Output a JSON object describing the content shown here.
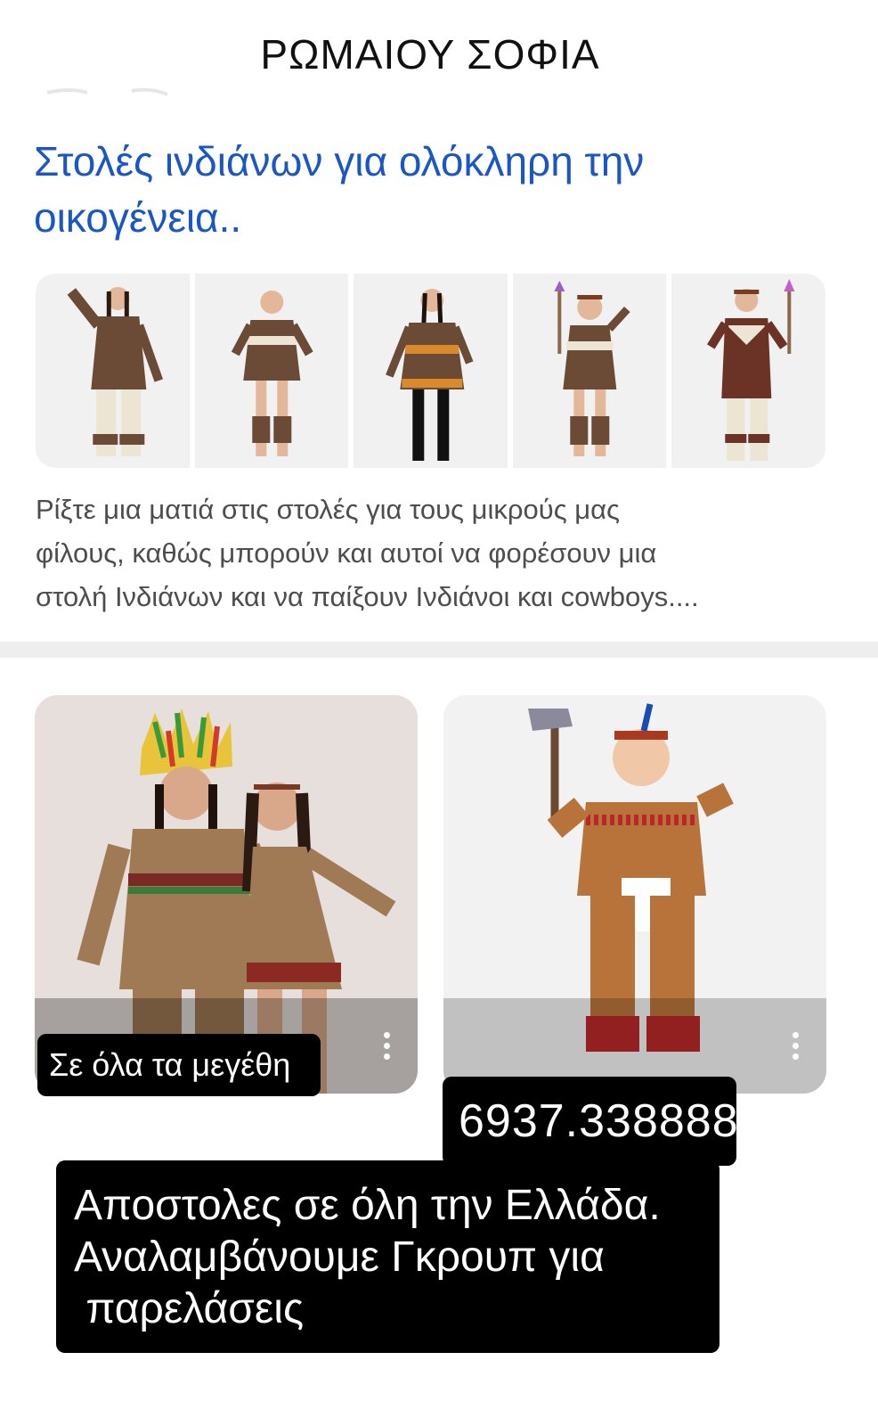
{
  "header": {
    "title": "ΡΩΜΑΙΟΥ ΣΟΦΙΑ"
  },
  "result": {
    "link_line1": "Στολές ινδιάνων για ολόκληρη την",
    "link_line2": "οικογένεια..",
    "snippet_line1": "Ρίξτε μια ματιά στις στολές για τους μικρούς μας",
    "snippet_line2": "φίλους, καθώς μπορούν και αυτοί να φορέσουν μια",
    "snippet_line3": "στολή Ινδιάνων και να παίξουν Ινδιάνοι και cowboys....",
    "thumbnails": [
      {
        "name": "man-costume-thumbnail"
      },
      {
        "name": "woman-costume-thumbnail"
      },
      {
        "name": "woman-black-boots-costume-thumbnail"
      },
      {
        "name": "girl-costume-thumbnail"
      },
      {
        "name": "boy-costume-thumbnail"
      }
    ]
  },
  "cards": [
    {
      "caption": "Σε όλα τα μεγέθη",
      "menu_icon": "more-vert-icon"
    },
    {
      "menu_icon": "more-vert-icon"
    }
  ],
  "overlay": {
    "phone": "6937.338888",
    "shipping_line1": "Αποστολες σε όλη την Ελλάδα.",
    "shipping_line2": "Αναλαμβάνουμε Γκρουπ για",
    "shipping_line3": " παρελάσεις"
  },
  "colors": {
    "link": "#1a57c4",
    "costume_brown": "#6b4a36",
    "label_bg": "#000000"
  }
}
